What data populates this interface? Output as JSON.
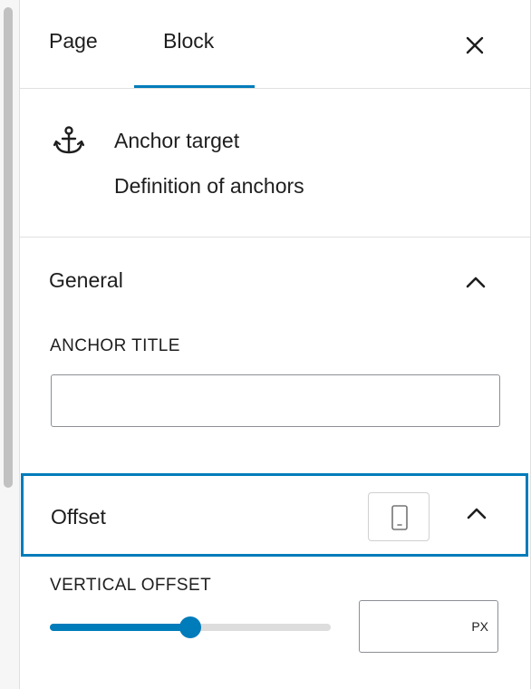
{
  "tabs": {
    "page_label": "Page",
    "block_label": "Block",
    "active": "block"
  },
  "close_icon": "close-icon",
  "block_card": {
    "icon": "anchor-icon",
    "title": "Anchor target",
    "description": "Definition of anchors"
  },
  "general_panel": {
    "title": "General",
    "expanded": true,
    "anchor_title": {
      "label": "ANCHOR TITLE",
      "value": "",
      "placeholder": ""
    }
  },
  "offset_panel": {
    "title": "Offset",
    "expanded": true,
    "device_icon": "mobile-device-icon",
    "vertical_offset": {
      "label": "VERTICAL OFFSET",
      "slider_fraction": 0.5,
      "value": "",
      "unit": "PX"
    }
  },
  "colors": {
    "accent": "#007cba",
    "border": "#e0e0e0",
    "text": "#1e1e1e"
  }
}
